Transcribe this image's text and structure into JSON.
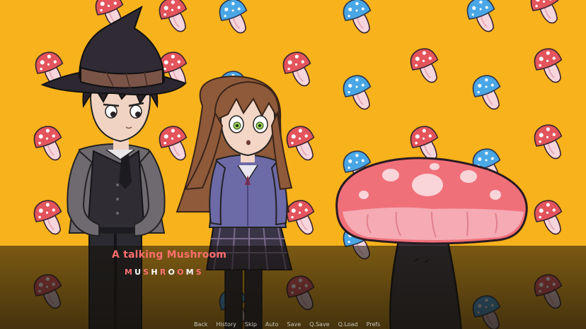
{
  "speaker": {
    "name": "A talking Mushroom",
    "color": "#ff6e6e"
  },
  "dialogue": {
    "text": "MUSHROOMS",
    "letter_colors": [
      "#ff7272",
      "#ffffff",
      "#ff7272",
      "#ffffff",
      "#ff7272",
      "#ffffff",
      "#ff7272",
      "#ffffff",
      "#ff7272"
    ]
  },
  "quick_menu": {
    "back": "Back",
    "history": "History",
    "skip": "Skip",
    "auto": "Auto",
    "save": "Save",
    "qsave": "Q.Save",
    "qload": "Q.Load",
    "prefs": "Prefs"
  },
  "colors": {
    "background": "#f7b21c",
    "mushroom_red": "#e3545c",
    "mushroom_blue": "#4aa7e6",
    "stem_pink": "#f6d6dc"
  }
}
